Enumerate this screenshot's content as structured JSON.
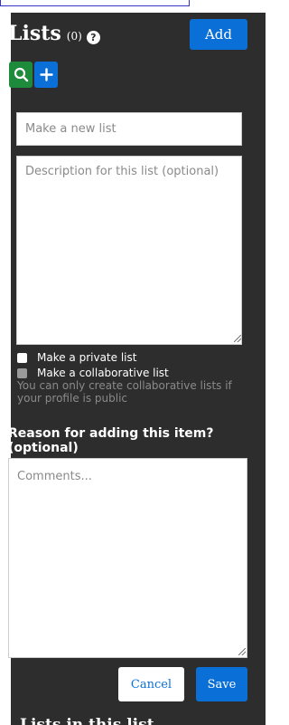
{
  "header": {
    "title": "Lists",
    "count": "(0)",
    "help_icon": "question-circle-icon",
    "add_label": "Add"
  },
  "toolbar": {
    "search_icon": "search-icon",
    "add_icon": "plus-icon"
  },
  "form": {
    "name_placeholder": "Make a new list",
    "name_value": "",
    "description_placeholder": "Description for this list (optional)",
    "description_value": "",
    "private_label": "Make a private list",
    "private_checked": false,
    "collaborative_label": "Make a collaborative list",
    "collaborative_checked": false,
    "collaborative_disabled": true,
    "collaborative_hint": "You can only create collaborative lists if your profile is public",
    "reason_label": "Reason for adding this item? (optional)",
    "comments_placeholder": "Comments...",
    "comments_value": "",
    "cancel_label": "Cancel",
    "save_label": "Save"
  },
  "below_fold": {
    "heading": "Lists in this list"
  },
  "colors": {
    "panel_background": "#2d2d2d",
    "primary_blue": "#0a6fd6",
    "search_green": "#1e8a3c",
    "hint_gray": "#8a8a8a"
  }
}
